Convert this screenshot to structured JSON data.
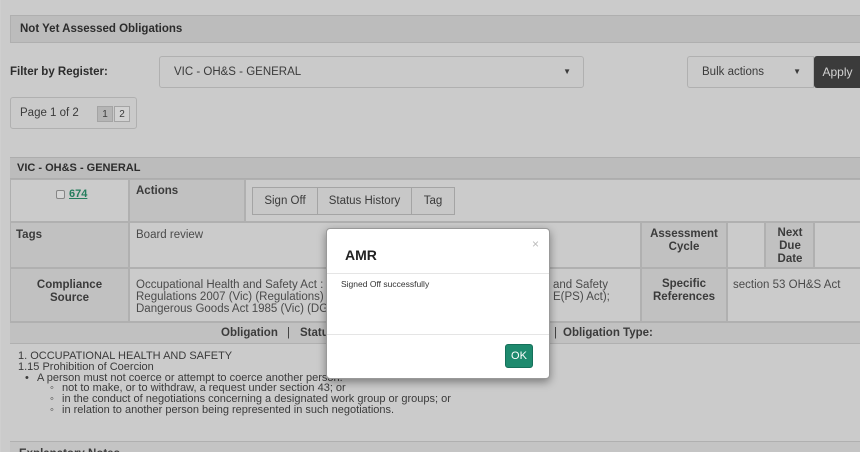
{
  "panel": {
    "title": "Not Yet Assessed Obligations"
  },
  "filter": {
    "label": "Filter by Register:",
    "register_value": "VIC - OH&S - GENERAL",
    "bulk_value": "Bulk actions",
    "apply_label": "Apply",
    "caret": "▼"
  },
  "pagination": {
    "text": "Page 1 of 2",
    "pages": [
      "1",
      "2"
    ]
  },
  "section": {
    "title": "VIC - OH&S - GENERAL"
  },
  "row": {
    "id_link": "674",
    "actions_label": "Actions",
    "buttons": [
      "Sign Off",
      "Status History",
      "Tag"
    ],
    "tags_label": "Tags",
    "tags_value": "Board review",
    "assessment_cycle_label": "Assessment Cycle",
    "next_due_label": "Next Due Date",
    "compliance_source_label": "Compliance Source",
    "compliance_source_lines": [
      "Occupational Health and Safety Act :",
      "Regulations 2007 (Vic) (Regulations)",
      "Dangerous Goods Act 1985 (Vic) (DG"
    ],
    "compliance_source_right": [
      "and Safety",
      "E(PS) Act);"
    ],
    "specific_references_label": "Specific References",
    "specific_references_value": "section 53 OH&S Act"
  },
  "obligation_bar": {
    "obligation_label": "Obligation",
    "sep": "|",
    "status_label": "Statu",
    "type_label": "Obligation Type:"
  },
  "obligation_text": {
    "heading": "1. OCCUPATIONAL HEALTH AND SAFETY",
    "subheading": "1.15 Prohibition of Coercion",
    "bullet": "A person must not coerce or attempt to coerce another person:",
    "subbullets": [
      "not to make, or to withdraw, a request under section 43; or",
      "in the conduct of negotiations concerning a designated work group or groups; or",
      "in relation to another person being represented in such negotiations."
    ]
  },
  "explanatory": {
    "label": "Explanatory Notes"
  },
  "modal": {
    "title": "AMR",
    "close": "×",
    "message": "Signed Off successfully",
    "ok_label": "OK"
  }
}
